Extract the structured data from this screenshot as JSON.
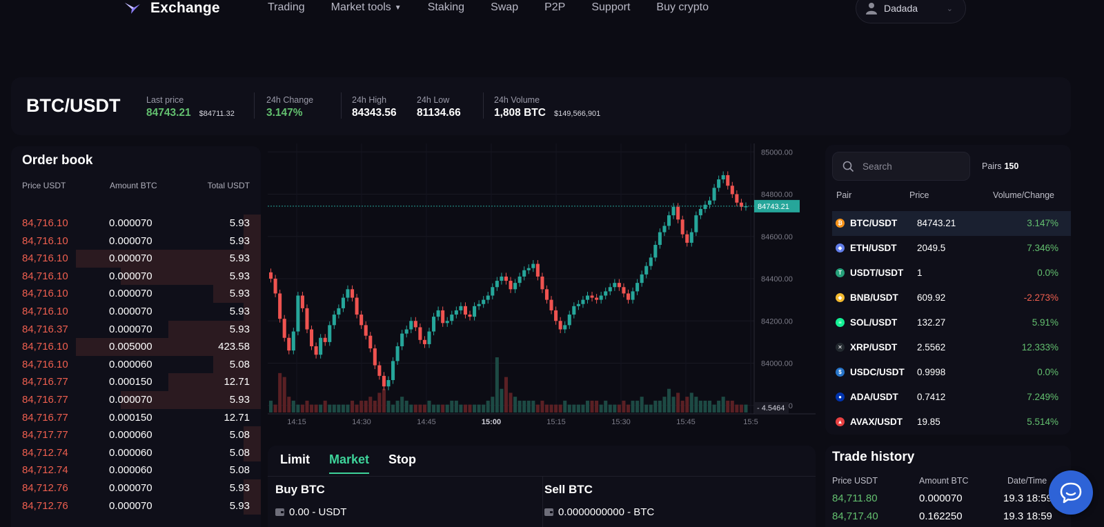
{
  "nav": {
    "logo_text": "Exchange",
    "items": [
      "Trading",
      "Market tools",
      "Staking",
      "Swap",
      "P2P",
      "Support",
      "Buy crypto"
    ],
    "user": "Dadada"
  },
  "ticker": {
    "pair": "BTC/USDT",
    "last_price_label": "Last price",
    "last_price": "84743.21",
    "last_price_usd": "$84711.32",
    "change_label": "24h Change",
    "change": "3.147%",
    "high_label": "24h High",
    "high": "84343.56",
    "low_label": "24h Low",
    "low": "81134.66",
    "volume_label": "24h Volume",
    "volume": "1,808 BTC",
    "volume_usd": "$149,566,901"
  },
  "orderbook": {
    "title": "Order book",
    "headers": [
      "Price USDT",
      "Amount BTC",
      "Total USDT"
    ],
    "rows": [
      {
        "price": "84,716.10",
        "amount": "0.000070",
        "total": "5.93",
        "depth": 0.07
      },
      {
        "price": "84,716.10",
        "amount": "0.000070",
        "total": "5.93",
        "depth": 0.07
      },
      {
        "price": "84,716.10",
        "amount": "0.000070",
        "total": "5.93",
        "depth": 0.74
      },
      {
        "price": "84,716.10",
        "amount": "0.000070",
        "total": "5.93",
        "depth": 0.56
      },
      {
        "price": "84,716.10",
        "amount": "0.000070",
        "total": "5.93",
        "depth": 0.19
      },
      {
        "price": "84,716.10",
        "amount": "0.000070",
        "total": "5.93",
        "depth": 0.07
      },
      {
        "price": "84,716.37",
        "amount": "0.000070",
        "total": "5.93",
        "depth": 0.37
      },
      {
        "price": "84,716.10",
        "amount": "0.005000",
        "total": "423.58",
        "depth": 0.74
      },
      {
        "price": "84,716.10",
        "amount": "0.000060",
        "total": "5.08",
        "depth": 0.19
      },
      {
        "price": "84,716.77",
        "amount": "0.000150",
        "total": "12.71",
        "depth": 0.37
      },
      {
        "price": "84,716.77",
        "amount": "0.000070",
        "total": "5.93",
        "depth": 0.56
      },
      {
        "price": "84,716.77",
        "amount": "0.000150",
        "total": "12.71",
        "depth": 0.0
      },
      {
        "price": "84,717.77",
        "amount": "0.000060",
        "total": "5.08",
        "depth": 0.07
      },
      {
        "price": "84,712.74",
        "amount": "0.000060",
        "total": "5.08",
        "depth": 0.07
      },
      {
        "price": "84,712.74",
        "amount": "0.000060",
        "total": "5.08",
        "depth": 0.0
      },
      {
        "price": "84,712.76",
        "amount": "0.000070",
        "total": "5.93",
        "depth": 0.07
      },
      {
        "price": "84,712.76",
        "amount": "0.000070",
        "total": "5.93",
        "depth": 0.07
      }
    ]
  },
  "chart_data": {
    "type": "candlestick",
    "y_ticks": [
      85000,
      84800,
      84600,
      84400,
      84200,
      84000,
      83800
    ],
    "x_ticks": [
      "14:15",
      "14:30",
      "14:45",
      "15:00",
      "15:15",
      "15:30",
      "15:45",
      "15:5"
    ],
    "current_price": "84743.21",
    "volume_label": "4.5464",
    "ylim": [
      83760,
      85040
    ],
    "closes": [
      84400,
      84330,
      84210,
      84120,
      84060,
      84150,
      84320,
      84260,
      84160,
      84080,
      84040,
      84120,
      84100,
      84180,
      84230,
      84260,
      84310,
      84350,
      84310,
      84230,
      84180,
      84130,
      84070,
      83990,
      83940,
      83890,
      83920,
      84010,
      84080,
      84140,
      84160,
      84200,
      84170,
      84110,
      84090,
      84150,
      84220,
      84250,
      84190,
      84200,
      84230,
      84250,
      84270,
      84230,
      84220,
      84270,
      84280,
      84300,
      84320,
      84360,
      84390,
      84410,
      84390,
      84350,
      84380,
      84410,
      84440,
      84450,
      84470,
      84410,
      84350,
      84300,
      84250,
      84200,
      84160,
      84180,
      84230,
      84270,
      84280,
      84300,
      84320,
      84310,
      84300,
      84320,
      84340,
      84360,
      84380,
      84360,
      84330,
      84300,
      84340,
      84380,
      84420,
      84460,
      84500,
      84560,
      84620,
      84650,
      84700,
      84740,
      84680,
      84610,
      84570,
      84620,
      84700,
      84730,
      84750,
      84770,
      84830,
      84870,
      84890,
      84840,
      84800,
      84760,
      84740,
      84743
    ],
    "volumes": [
      3,
      2,
      10,
      9,
      4,
      3,
      2,
      2,
      3,
      2,
      2,
      2,
      3,
      2,
      2,
      2,
      2,
      2,
      3,
      2,
      3,
      3,
      4,
      3,
      5,
      6,
      3,
      2,
      3,
      4,
      3,
      2,
      2,
      2,
      2,
      3,
      2,
      2,
      2,
      2,
      3,
      3,
      2,
      2,
      2,
      2,
      2,
      2,
      3,
      4,
      14,
      6,
      9,
      5,
      4,
      3,
      3,
      3,
      3,
      2,
      3,
      2,
      2,
      2,
      2,
      3,
      2,
      2,
      2,
      2,
      3,
      3,
      3,
      2,
      3,
      2,
      2,
      2,
      3,
      2,
      3,
      3,
      4,
      2,
      2,
      3,
      3,
      4,
      6,
      4,
      5,
      3,
      4,
      5,
      4,
      3,
      3,
      3,
      2,
      3,
      4,
      3,
      3,
      2,
      2,
      2
    ]
  },
  "orderform": {
    "tabs": [
      "Limit",
      "Market",
      "Stop"
    ],
    "active_tab": "Market",
    "buy_title": "Buy BTC",
    "buy_balance": "0.00 - USDT",
    "sell_title": "Sell BTC",
    "sell_balance": "0.0000000000 - BTC"
  },
  "pairs": {
    "search_placeholder": "Search",
    "count_label": "Pairs",
    "count": "150",
    "headers": [
      "Pair",
      "Price",
      "Volume/Change"
    ],
    "rows": [
      {
        "pair": "BTC/USDT",
        "price": "84743.21",
        "change": "3.147%",
        "dir": "up",
        "color": "#f7931a",
        "glyph": "₿"
      },
      {
        "pair": "ETH/USDT",
        "price": "2049.5",
        "change": "7.346%",
        "dir": "up",
        "color": "#627eea",
        "glyph": "◆"
      },
      {
        "pair": "USDT/USDT",
        "price": "1",
        "change": "0.0%",
        "dir": "up",
        "color": "#26a17b",
        "glyph": "T"
      },
      {
        "pair": "BNB/USDT",
        "price": "609.92",
        "change": "-2.273%",
        "dir": "down",
        "color": "#f3ba2f",
        "glyph": "◆"
      },
      {
        "pair": "SOL/USDT",
        "price": "132.27",
        "change": "5.91%",
        "dir": "up",
        "color": "#14f195",
        "glyph": "≡"
      },
      {
        "pair": "XRP/USDT",
        "price": "2.5562",
        "change": "12.333%",
        "dir": "up",
        "color": "#23292f",
        "glyph": "✕"
      },
      {
        "pair": "USDC/USDT",
        "price": "0.9998",
        "change": "0.0%",
        "dir": "up",
        "color": "#2775ca",
        "glyph": "$"
      },
      {
        "pair": "ADA/USDT",
        "price": "0.7412",
        "change": "7.249%",
        "dir": "up",
        "color": "#0033ad",
        "glyph": "●"
      },
      {
        "pair": "AVAX/USDT",
        "price": "19.85",
        "change": "5.514%",
        "dir": "up",
        "color": "#e84142",
        "glyph": "▲"
      }
    ]
  },
  "history": {
    "title": "Trade history",
    "headers": [
      "Price USDT",
      "Amount BTC",
      "Date/Time"
    ],
    "rows": [
      {
        "price": "84,711.80",
        "amount": "0.000070",
        "time": "19.3 18:59"
      },
      {
        "price": "84,717.40",
        "amount": "0.162250",
        "time": "19.3 18:59"
      }
    ]
  },
  "colors": {
    "up": "#26a69a",
    "down": "#ef5350",
    "accent": "#3ed39a"
  }
}
